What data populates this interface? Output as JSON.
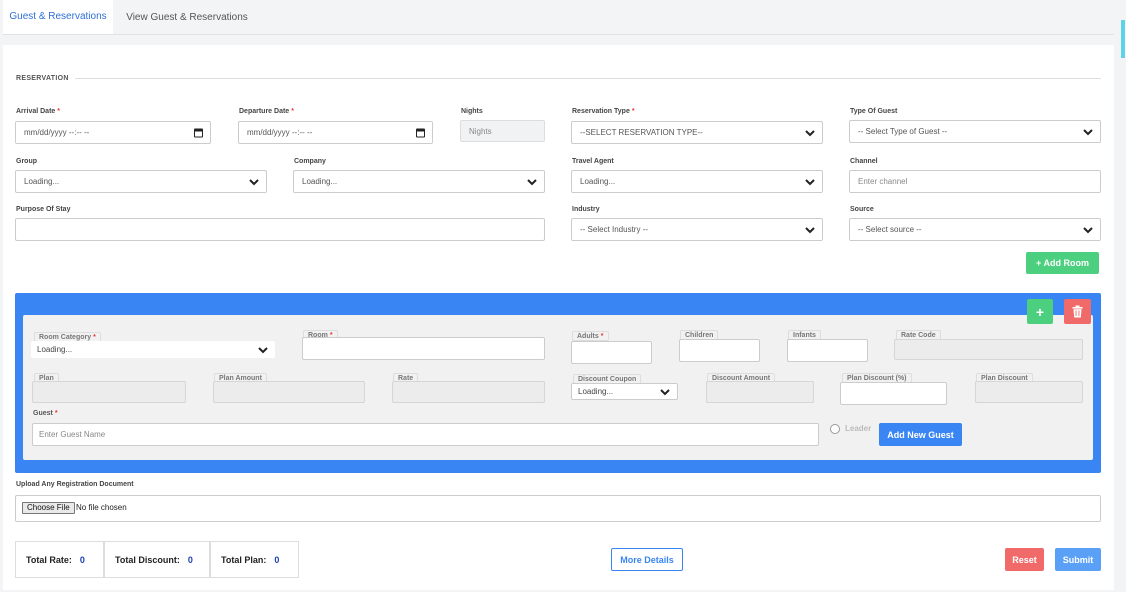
{
  "tabs": [
    {
      "label": "Guest & Reservations"
    },
    {
      "label": "View Guest & Reservations"
    }
  ],
  "section": {
    "title": "RESERVATION"
  },
  "fields": {
    "arrival_date": {
      "label": "Arrival Date",
      "value": "mm/dd/yyyy --:-- --"
    },
    "departure_date": {
      "label": "Departure Date",
      "value": "mm/dd/yyyy --:-- --"
    },
    "nights": {
      "label": "Nights",
      "placeholder": "Nights"
    },
    "reservation_type": {
      "label": "Reservation Type",
      "value": "--SELECT RESERVATION TYPE--"
    },
    "type_of_guest": {
      "label": "Type Of Guest",
      "value": "-- Select Type of Guest --"
    },
    "group": {
      "label": "Group",
      "value": "Loading..."
    },
    "company": {
      "label": "Company",
      "value": "Loading..."
    },
    "travel_agent": {
      "label": "Travel Agent",
      "value": "Loading..."
    },
    "channel": {
      "label": "Channel",
      "placeholder": "Enter channel"
    },
    "purpose_of_stay": {
      "label": "Purpose Of Stay",
      "value": ""
    },
    "industry": {
      "label": "Industry",
      "value": "-- Select Industry --"
    },
    "source": {
      "label": "Source",
      "value": "-- Select source --"
    }
  },
  "add_room_label": "+ Add Room",
  "room": {
    "plus_label": "+",
    "room_category": {
      "label": "Room Category",
      "value": "Loading..."
    },
    "room_label": "Room",
    "adults_label": "Adults",
    "children_label": "Children",
    "infants_label": "Infants",
    "rate_code_label": "Rate Code",
    "plan_label": "Plan",
    "plan_amount_label": "Plan Amount",
    "rate_label": "Rate",
    "discount_coupon": {
      "label": "Discount Coupon",
      "value": "Loading..."
    },
    "discount_amount_label": "Discount Amount",
    "plan_discount_pct_label": "Plan Discount (%)",
    "plan_discount_label": "Plan Discount",
    "guest": {
      "label": "Guest",
      "placeholder": "Enter Guest Name"
    },
    "leader_label": "Leader",
    "add_new_guest_label": "Add New Guest"
  },
  "upload": {
    "label": "Upload Any Registration Document",
    "button": "Choose File",
    "status": "No file chosen"
  },
  "totals": {
    "rate_label": "Total Rate:",
    "rate_value": "0",
    "discount_label": "Total Discount:",
    "discount_value": "0",
    "plan_label": "Total Plan:",
    "plan_value": "0"
  },
  "more_details_label": "More Details",
  "reset_label": "Reset",
  "submit_label": "Submit",
  "colors": {
    "accent": "#3a85f4",
    "green": "#4ccf7f",
    "red": "#f06a6a"
  }
}
